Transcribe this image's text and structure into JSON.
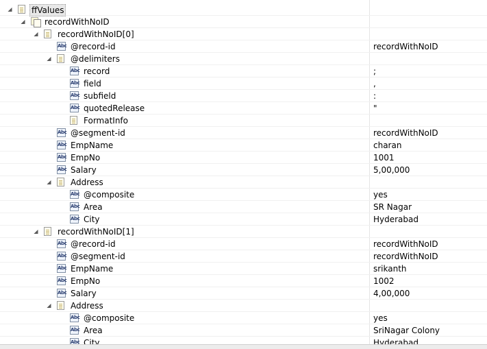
{
  "rows": [
    {
      "level": 0,
      "toggle": "open",
      "icon": "doc",
      "label": "ffValues",
      "value": "",
      "selected": true
    },
    {
      "level": 1,
      "toggle": "open",
      "icon": "docs",
      "label": "recordWithNoID",
      "value": ""
    },
    {
      "level": 2,
      "toggle": "open",
      "icon": "doc",
      "label": "recordWithNoID[0]",
      "value": ""
    },
    {
      "level": 3,
      "toggle": "",
      "icon": "abc",
      "label": "@record-id",
      "value": "recordWithNoID"
    },
    {
      "level": 3,
      "toggle": "open",
      "icon": "doc",
      "label": "@delimiters",
      "value": ""
    },
    {
      "level": 4,
      "toggle": "",
      "icon": "abc",
      "label": "record",
      "value": ";"
    },
    {
      "level": 4,
      "toggle": "",
      "icon": "abc",
      "label": "field",
      "value": ","
    },
    {
      "level": 4,
      "toggle": "",
      "icon": "abc",
      "label": "subfield",
      "value": ":"
    },
    {
      "level": 4,
      "toggle": "",
      "icon": "abc",
      "label": "quotedRelease",
      "value": "\""
    },
    {
      "level": 4,
      "toggle": "",
      "icon": "doc",
      "label": "FormatInfo",
      "value": ""
    },
    {
      "level": 3,
      "toggle": "",
      "icon": "abc",
      "label": "@segment-id",
      "value": "recordWithNoID"
    },
    {
      "level": 3,
      "toggle": "",
      "icon": "abc",
      "label": "EmpName",
      "value": "charan"
    },
    {
      "level": 3,
      "toggle": "",
      "icon": "abc",
      "label": "EmpNo",
      "value": "1001"
    },
    {
      "level": 3,
      "toggle": "",
      "icon": "abc",
      "label": "Salary",
      "value": "5,00,000"
    },
    {
      "level": 3,
      "toggle": "open",
      "icon": "doc",
      "label": "Address",
      "value": ""
    },
    {
      "level": 4,
      "toggle": "",
      "icon": "abc",
      "label": "@composite",
      "value": "yes"
    },
    {
      "level": 4,
      "toggle": "",
      "icon": "abc",
      "label": "Area",
      "value": "SR Nagar"
    },
    {
      "level": 4,
      "toggle": "",
      "icon": "abc",
      "label": "City",
      "value": "Hyderabad"
    },
    {
      "level": 2,
      "toggle": "open",
      "icon": "doc",
      "label": "recordWithNoID[1]",
      "value": ""
    },
    {
      "level": 3,
      "toggle": "",
      "icon": "abc",
      "label": "@record-id",
      "value": "recordWithNoID"
    },
    {
      "level": 3,
      "toggle": "",
      "icon": "abc",
      "label": "@segment-id",
      "value": "recordWithNoID"
    },
    {
      "level": 3,
      "toggle": "",
      "icon": "abc",
      "label": "EmpName",
      "value": "srikanth"
    },
    {
      "level": 3,
      "toggle": "",
      "icon": "abc",
      "label": "EmpNo",
      "value": "1002"
    },
    {
      "level": 3,
      "toggle": "",
      "icon": "abc",
      "label": "Salary",
      "value": "4,00,000"
    },
    {
      "level": 3,
      "toggle": "open",
      "icon": "doc",
      "label": "Address",
      "value": ""
    },
    {
      "level": 4,
      "toggle": "",
      "icon": "abc",
      "label": "@composite",
      "value": "yes"
    },
    {
      "level": 4,
      "toggle": "",
      "icon": "abc",
      "label": "Area",
      "value": "SriNagar Colony"
    },
    {
      "level": 4,
      "toggle": "",
      "icon": "abc",
      "label": "City",
      "value": "Hyderabad"
    }
  ]
}
